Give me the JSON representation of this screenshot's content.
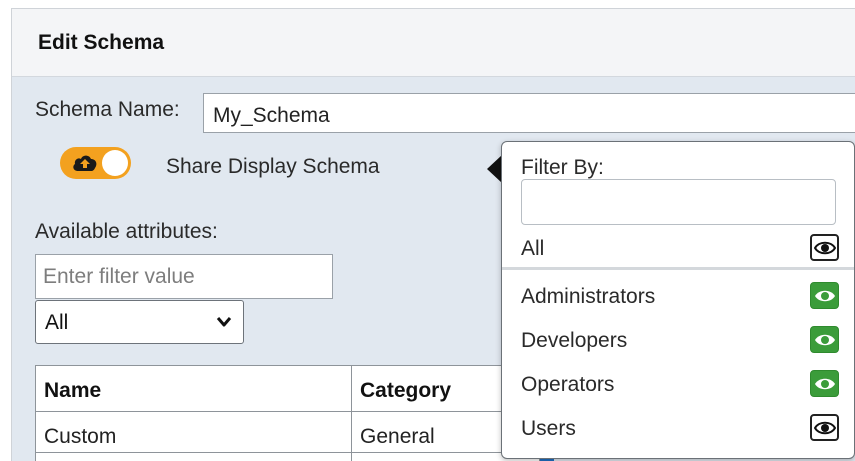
{
  "dialog": {
    "title": "Edit Schema"
  },
  "form": {
    "schema_name_label": "Schema Name:",
    "schema_name_value": "My_Schema",
    "share_toggle": {
      "label": "Share Display Schema",
      "on": true,
      "icon": "cloud-upload-icon",
      "color": "#f3a11f"
    },
    "available_attributes_label": "Available attributes:",
    "filter_placeholder": "Enter filter value",
    "category_select": {
      "selected": "All"
    }
  },
  "attributes_table": {
    "columns": [
      "Name",
      "Category"
    ],
    "rows": [
      [
        "Custom",
        "General"
      ]
    ]
  },
  "share_popover": {
    "filter_label": "Filter By:",
    "filter_value": "",
    "all": {
      "label": "All",
      "visible": false
    },
    "groups": [
      {
        "label": "Administrators",
        "visible": true
      },
      {
        "label": "Developers",
        "visible": true
      },
      {
        "label": "Operators",
        "visible": true
      },
      {
        "label": "Users",
        "visible": false
      }
    ],
    "visible_color": "#3b9c3a"
  }
}
